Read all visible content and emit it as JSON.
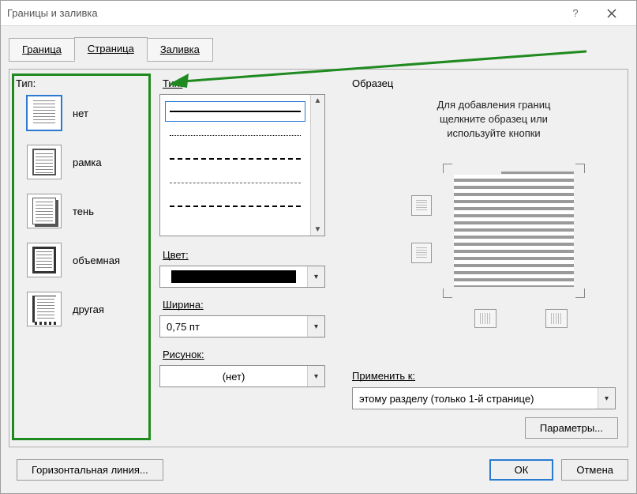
{
  "window": {
    "title": "Границы и заливка"
  },
  "tabs": {
    "border": "Граница",
    "page": "Страница",
    "shading": "Заливка"
  },
  "col1": {
    "label": "Тип:",
    "settings": [
      {
        "name": "none",
        "label": "нет"
      },
      {
        "name": "box",
        "label": "рамка"
      },
      {
        "name": "shadow",
        "label": "тень"
      },
      {
        "name": "threed",
        "label": "объемная"
      },
      {
        "name": "other",
        "label": "другая"
      }
    ]
  },
  "col2": {
    "style_label": "Тип:",
    "color_label": "Цвет:",
    "width_label": "Ширина:",
    "width_value": "0,75 пт",
    "art_label": "Рисунок:",
    "art_value": "(нет)"
  },
  "col3": {
    "preview_label": "Образец",
    "hint_line1": "Для добавления границ",
    "hint_line2": "щелкните образец или",
    "hint_line3": "используйте кнопки",
    "apply_label": "Применить к:",
    "apply_value": "этому разделу (только 1-й странице)",
    "params_btn": "Параметры..."
  },
  "footer": {
    "hrule": "Горизонтальная линия...",
    "ok": "ОК",
    "cancel": "Отмена"
  }
}
